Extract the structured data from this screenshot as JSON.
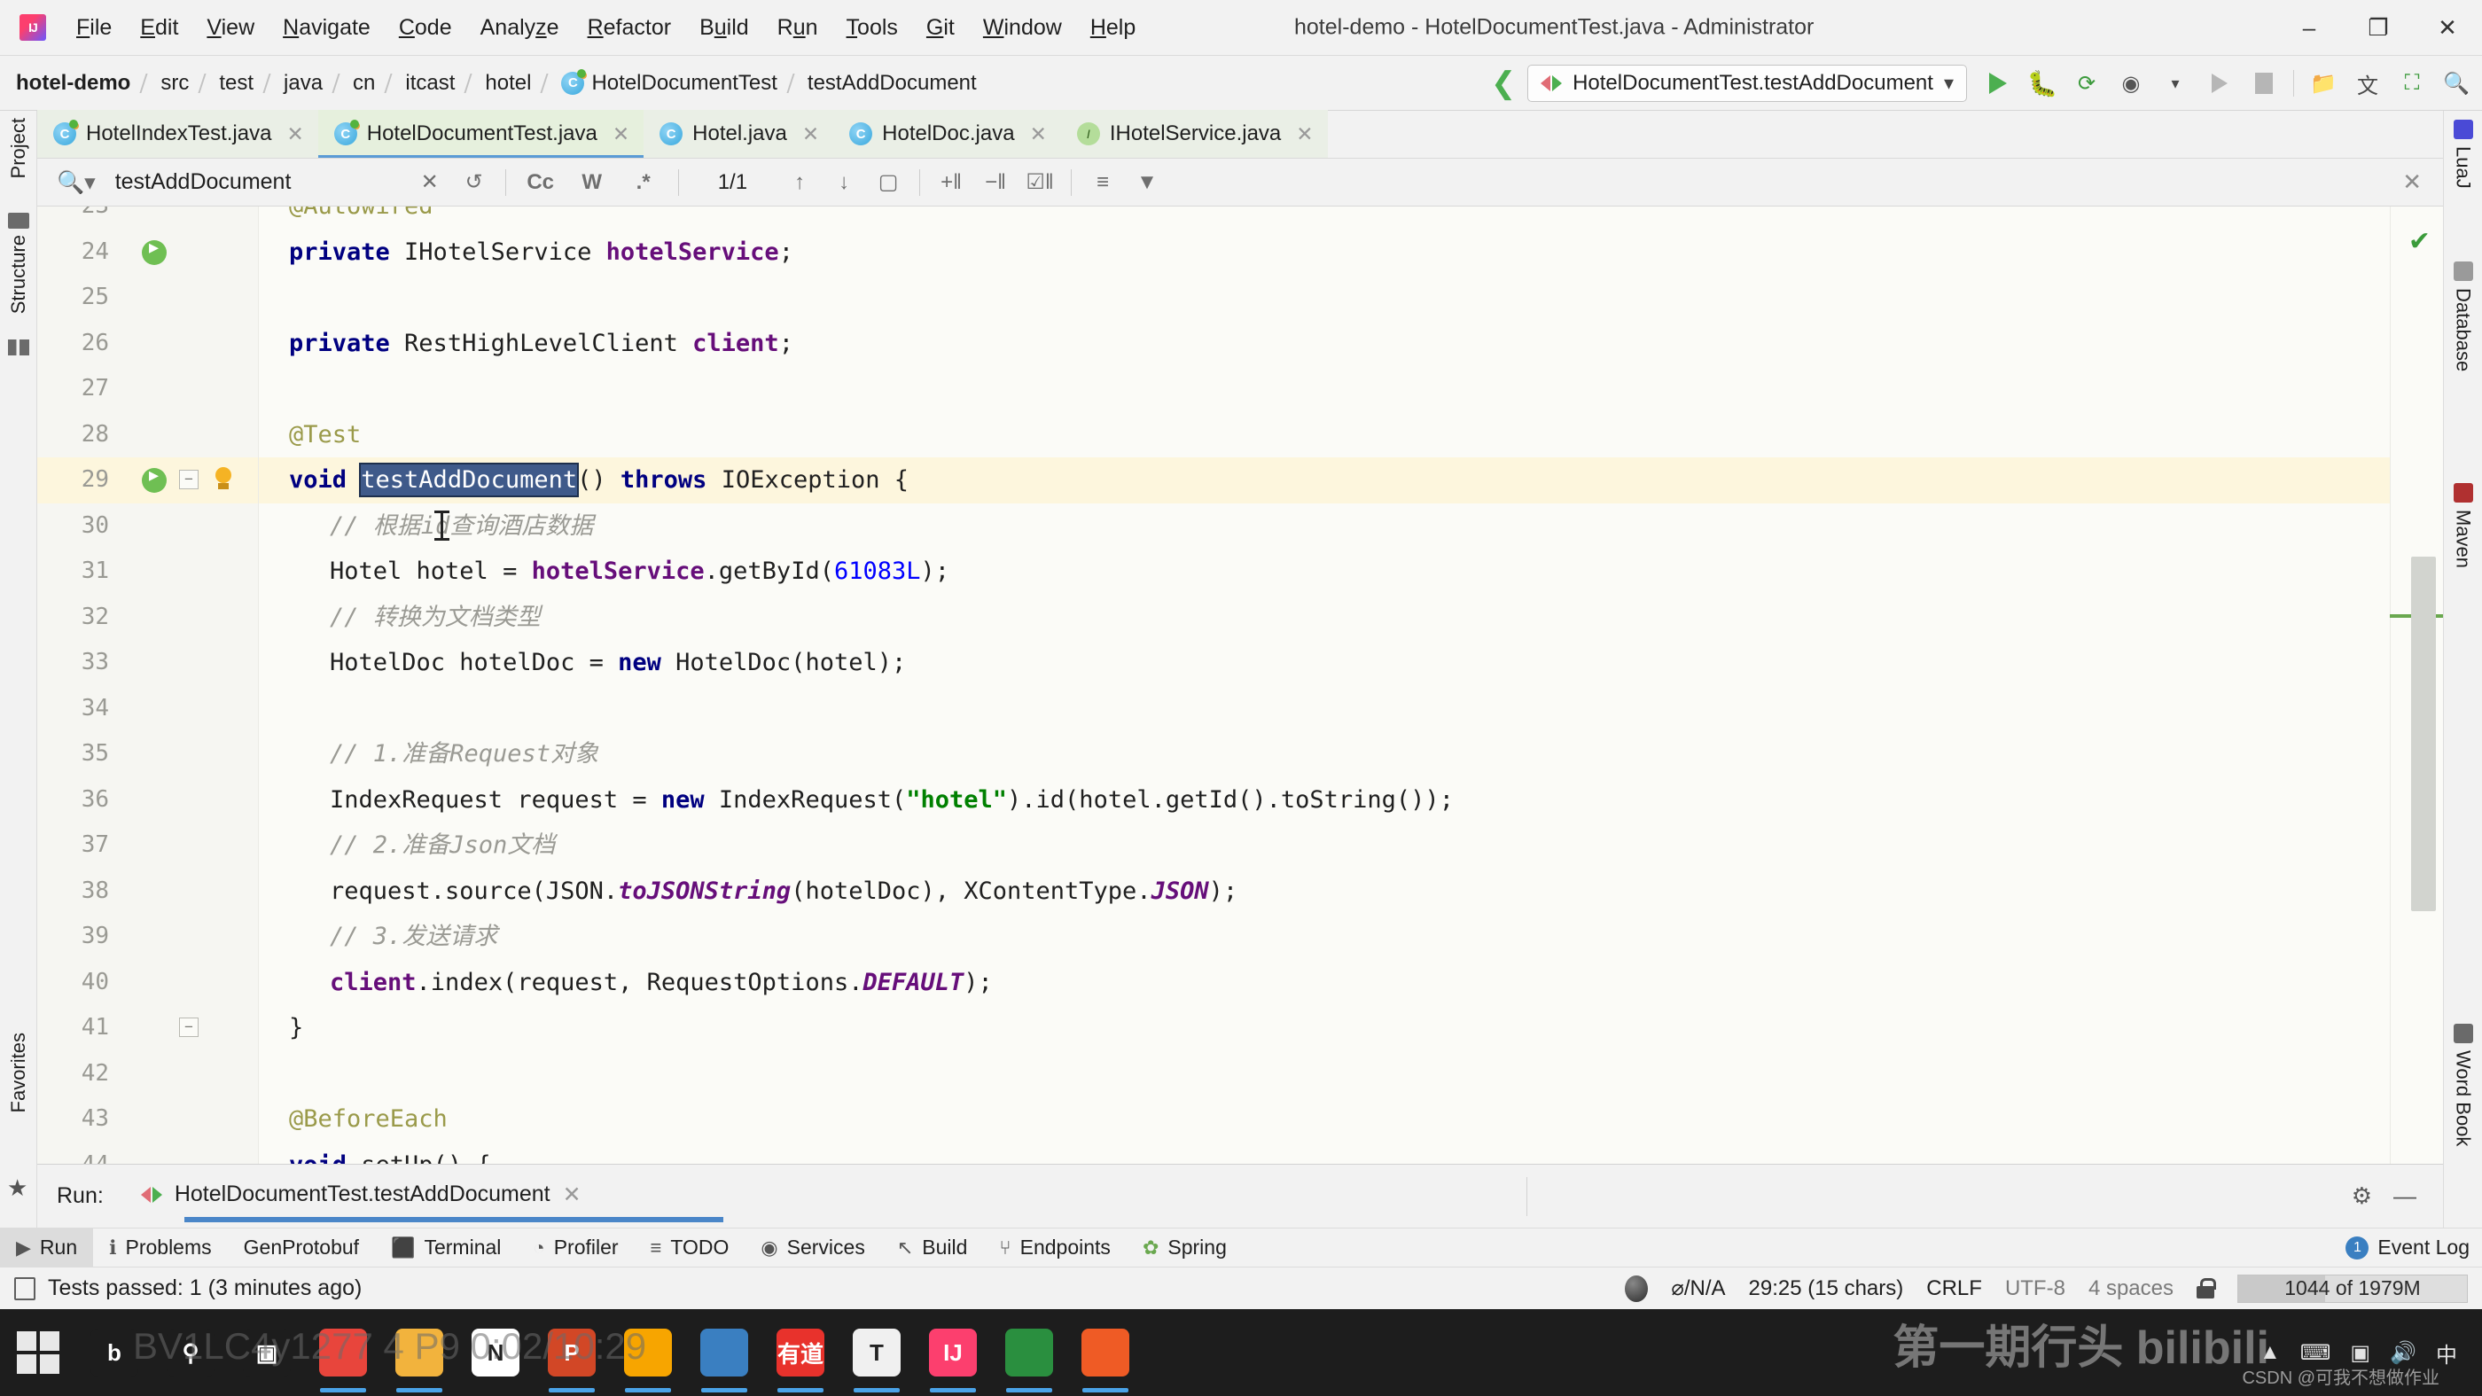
{
  "window": {
    "title": "hotel-demo - HotelDocumentTest.java - Administrator",
    "minimize": "–",
    "maximize": "❐",
    "close": "✕",
    "logo": "intellij-idea-logo"
  },
  "menubar": {
    "items": [
      {
        "pre": "",
        "mn": "F",
        "post": "ile"
      },
      {
        "pre": "",
        "mn": "E",
        "post": "dit"
      },
      {
        "pre": "",
        "mn": "V",
        "post": "iew"
      },
      {
        "pre": "",
        "mn": "N",
        "post": "avigate"
      },
      {
        "pre": "",
        "mn": "C",
        "post": "ode"
      },
      {
        "pre": "Analy",
        "mn": "z",
        "post": "e"
      },
      {
        "pre": "",
        "mn": "R",
        "post": "efactor"
      },
      {
        "pre": "B",
        "mn": "u",
        "post": "ild"
      },
      {
        "pre": "R",
        "mn": "u",
        "post": "n"
      },
      {
        "pre": "",
        "mn": "T",
        "post": "ools"
      },
      {
        "pre": "",
        "mn": "G",
        "post": "it"
      },
      {
        "pre": "",
        "mn": "W",
        "post": "indow"
      },
      {
        "pre": "",
        "mn": "H",
        "post": "elp"
      }
    ]
  },
  "breadcrumbs": {
    "items": [
      {
        "label": "hotel-demo",
        "bold": true,
        "icon": "none"
      },
      {
        "label": "src",
        "bold": false,
        "icon": "none"
      },
      {
        "label": "test",
        "bold": false,
        "icon": "none"
      },
      {
        "label": "java",
        "bold": false,
        "icon": "none"
      },
      {
        "label": "cn",
        "bold": false,
        "icon": "none"
      },
      {
        "label": "itcast",
        "bold": false,
        "icon": "none"
      },
      {
        "label": "hotel",
        "bold": false,
        "icon": "none"
      },
      {
        "label": "HotelDocumentTest",
        "bold": false,
        "icon": "class-test-icon"
      },
      {
        "label": "testAddDocument",
        "bold": false,
        "icon": "none"
      }
    ]
  },
  "run_toolbar": {
    "back_icon": "back-arrow-icon",
    "config_name": "HotelDocumentTest.testAddDocument",
    "config_chevron": "▾",
    "run_icon": "run-icon",
    "debug_icon": "debug-icon",
    "run_coverage_icon": "run-with-coverage-icon",
    "profiler_icon": "profiler-icon",
    "profiler_chevron": "▾",
    "rerun_icon": "rerun-icon",
    "stop_icon": "stop-icon",
    "update_icon": "update-project-icon",
    "translate_icon": "translate-icon",
    "console_icon": "console-icon",
    "search_icon": "search-everywhere-icon"
  },
  "editor_tabs": [
    {
      "label": "HotelIndexTest.java",
      "icon": "class-test-icon",
      "active": false,
      "close": "✕"
    },
    {
      "label": "HotelDocumentTest.java",
      "icon": "class-test-icon",
      "active": true,
      "close": "✕"
    },
    {
      "label": "Hotel.java",
      "icon": "class-icon",
      "active": false,
      "close": "✕"
    },
    {
      "label": "HotelDoc.java",
      "icon": "class-icon",
      "active": false,
      "close": "✕"
    },
    {
      "label": "IHotelService.java",
      "icon": "interface-icon",
      "active": false,
      "close": "✕"
    }
  ],
  "find_bar": {
    "search_icon": "search-dropdown-icon",
    "value": "testAddDocument",
    "placeholder": "Search",
    "clear": "✕",
    "history": "↺",
    "match_case": "Cc",
    "words": "W",
    "regex": ".*",
    "count": "1/1",
    "prev": "↑",
    "next": "↓",
    "select_all": "select-all-occurrences-icon",
    "add_line": "add-line-icon",
    "remove_line": "remove-line-icon",
    "check_line": "check-line-icon",
    "filter_results": "filter-results-icon",
    "filter": "filter-icon",
    "close": "✕"
  },
  "left_strip": {
    "project": "Project",
    "structure": "Structure",
    "favorites": "Favorites"
  },
  "right_strip": {
    "items": [
      "LuaJ",
      "Database",
      "Maven",
      "Word Book"
    ]
  },
  "editor": {
    "lines": [
      {
        "num": "23",
        "indent": 0,
        "tokens": [
          {
            "t": "@Autowired",
            "c": "ann"
          }
        ],
        "clipped": true
      },
      {
        "num": "24",
        "indent": 0,
        "gutter": "run-marker",
        "tokens": [
          {
            "t": "private ",
            "c": "kw"
          },
          {
            "t": "IHotelService ",
            "c": "pln"
          },
          {
            "t": "hotelService",
            "c": "fld"
          },
          {
            "t": ";",
            "c": "pln"
          }
        ]
      },
      {
        "num": "25",
        "indent": 0,
        "tokens": []
      },
      {
        "num": "26",
        "indent": 0,
        "tokens": [
          {
            "t": "private ",
            "c": "kw"
          },
          {
            "t": "RestHighLevelClient ",
            "c": "pln"
          },
          {
            "t": "client",
            "c": "fld"
          },
          {
            "t": ";",
            "c": "pln"
          }
        ]
      },
      {
        "num": "27",
        "indent": 0,
        "tokens": []
      },
      {
        "num": "28",
        "indent": 0,
        "tokens": [
          {
            "t": "@Test",
            "c": "ann"
          }
        ]
      },
      {
        "num": "29",
        "indent": 0,
        "gutter": "run-marker-bulb",
        "highlight": true,
        "tokens": [
          {
            "t": "void ",
            "c": "kw"
          },
          {
            "t": "testAddDocument",
            "c": "sel"
          },
          {
            "t": "() ",
            "c": "pln"
          },
          {
            "t": "throws ",
            "c": "kw"
          },
          {
            "t": "IOException {",
            "c": "pln"
          }
        ]
      },
      {
        "num": "30",
        "indent": 1,
        "caret": true,
        "tokens": [
          {
            "t": "// 根据id查询酒店数据",
            "c": "cmt"
          }
        ]
      },
      {
        "num": "31",
        "indent": 1,
        "tokens": [
          {
            "t": "Hotel hotel = ",
            "c": "pln"
          },
          {
            "t": "hotelService",
            "c": "fld"
          },
          {
            "t": ".getById(",
            "c": "pln"
          },
          {
            "t": "61083L",
            "c": "num"
          },
          {
            "t": ");",
            "c": "pln"
          }
        ]
      },
      {
        "num": "32",
        "indent": 1,
        "tokens": [
          {
            "t": "// 转换为文档类型",
            "c": "cmt"
          }
        ]
      },
      {
        "num": "33",
        "indent": 1,
        "tokens": [
          {
            "t": "HotelDoc hotelDoc = ",
            "c": "pln"
          },
          {
            "t": "new ",
            "c": "kw"
          },
          {
            "t": "HotelDoc(hotel);",
            "c": "pln"
          }
        ]
      },
      {
        "num": "34",
        "indent": 1,
        "tokens": []
      },
      {
        "num": "35",
        "indent": 1,
        "tokens": [
          {
            "t": "// 1.准备Request对象",
            "c": "cmt"
          }
        ]
      },
      {
        "num": "36",
        "indent": 1,
        "tokens": [
          {
            "t": "IndexRequest request = ",
            "c": "pln"
          },
          {
            "t": "new ",
            "c": "kw"
          },
          {
            "t": "IndexRequest(",
            "c": "pln"
          },
          {
            "t": "\"hotel\"",
            "c": "str"
          },
          {
            "t": ").id(hotel.getId().toString());",
            "c": "pln"
          }
        ]
      },
      {
        "num": "37",
        "indent": 1,
        "tokens": [
          {
            "t": "// 2.准备Json文档",
            "c": "cmt"
          }
        ]
      },
      {
        "num": "38",
        "indent": 1,
        "tokens": [
          {
            "t": "request.source(JSON.",
            "c": "pln"
          },
          {
            "t": "toJSONString",
            "c": "stc"
          },
          {
            "t": "(hotelDoc), XContentType.",
            "c": "pln"
          },
          {
            "t": "JSON",
            "c": "stc"
          },
          {
            "t": ");",
            "c": "pln"
          }
        ]
      },
      {
        "num": "39",
        "indent": 1,
        "tokens": [
          {
            "t": "// 3.发送请求",
            "c": "cmt"
          }
        ]
      },
      {
        "num": "40",
        "indent": 1,
        "tokens": [
          {
            "t": "client",
            "c": "fld"
          },
          {
            "t": ".index(request, RequestOptions.",
            "c": "pln"
          },
          {
            "t": "DEFAULT",
            "c": "stc"
          },
          {
            "t": ");",
            "c": "pln"
          }
        ]
      },
      {
        "num": "41",
        "indent": 0,
        "gutter": "fold",
        "tokens": [
          {
            "t": "}",
            "c": "pln"
          }
        ]
      },
      {
        "num": "42",
        "indent": 0,
        "tokens": []
      },
      {
        "num": "43",
        "indent": 0,
        "tokens": [
          {
            "t": "@BeforeEach",
            "c": "ann"
          }
        ]
      },
      {
        "num": "44",
        "indent": 0,
        "clipped_bottom": true,
        "tokens": [
          {
            "t": "void ",
            "c": "kw"
          },
          {
            "t": "setUp() {",
            "c": "pln"
          }
        ]
      }
    ],
    "ok_check": "✔"
  },
  "run_panel": {
    "label": "Run:",
    "tab_title": "HotelDocumentTest.testAddDocument",
    "tab_close": "✕",
    "settings_icon": "gear-icon",
    "minimize_icon": "—"
  },
  "bottom_toolwindows": [
    {
      "label": "Run",
      "icon": "run-icon",
      "active": true
    },
    {
      "label": "Problems",
      "icon": "problems-icon",
      "active": false
    },
    {
      "label": "GenProtobuf",
      "icon": "",
      "active": false
    },
    {
      "label": "Terminal",
      "icon": "terminal-icon",
      "active": false
    },
    {
      "label": "Profiler",
      "icon": "profiler-icon",
      "active": false
    },
    {
      "label": "TODO",
      "icon": "todo-icon",
      "active": false
    },
    {
      "label": "Services",
      "icon": "services-icon",
      "active": false
    },
    {
      "label": "Build",
      "icon": "build-icon",
      "active": false
    },
    {
      "label": "Endpoints",
      "icon": "endpoints-icon",
      "active": false
    },
    {
      "label": "Spring",
      "icon": "spring-icon",
      "active": false
    }
  ],
  "event_log": {
    "label": "Event Log",
    "badge": "1"
  },
  "status_bar": {
    "message": "Tests passed: 1 (3 minutes ago)",
    "doc_icon": "document-icon",
    "vcs": "⌀/N/A",
    "caret_pos": "29:25 (15 chars)",
    "line_sep": "CRLF",
    "encoding": "UTF-8",
    "indent": "4 spaces",
    "lock_icon": "lock-icon",
    "memory": "1044 of 1979M"
  },
  "taskbar": {
    "start": "windows-start-icon",
    "items": [
      {
        "name": "bilibili-icon",
        "label": "b",
        "color": "#1d1d1d",
        "running": false
      },
      {
        "name": "search-icon",
        "label": "⚲",
        "color": "#1d1d1d",
        "running": false
      },
      {
        "name": "task-view-icon",
        "label": "▣",
        "color": "#1d1d1d",
        "running": false
      },
      {
        "name": "chrome-icon",
        "label": "",
        "color": "#e8453c",
        "running": true
      },
      {
        "name": "file-explorer-icon",
        "label": "",
        "color": "#f2b33d",
        "running": true
      },
      {
        "name": "notepad-icon",
        "label": "N",
        "color": "#ffffff",
        "running": false
      },
      {
        "name": "powerpoint-icon",
        "label": "P",
        "color": "#d24726",
        "running": true
      },
      {
        "name": "vmware-icon",
        "label": "",
        "color": "#f7a500",
        "running": true
      },
      {
        "name": "remote-desktop-icon",
        "label": "",
        "color": "#3a7fc1",
        "running": true
      },
      {
        "name": "youdao-dict-icon",
        "label": "有道",
        "color": "#e8322c",
        "running": true
      },
      {
        "name": "typora-icon",
        "label": "T",
        "color": "#f0f0f0",
        "running": true
      },
      {
        "name": "intellij-idea-icon",
        "label": "IJ",
        "color": "#fc3f6e",
        "running": true
      },
      {
        "name": "navicat-icon",
        "label": "",
        "color": "#2a8f3f",
        "running": true
      },
      {
        "name": "postman-icon",
        "label": "",
        "color": "#ef5b25",
        "running": true
      }
    ],
    "tray": [
      "▲",
      "⌨",
      "▣",
      "🔊",
      "中"
    ],
    "ghost_overlay": "BV1LC4y1277 4 P9  0:02/10:29",
    "ghost_overlay_2": "第一期行头 bilibili",
    "watermark": "CSDN @可我不想做作业"
  },
  "colors": {
    "accent": "#4a86c8",
    "run_green": "#4caf50",
    "selection": "#3f5a8a",
    "highlight_line": "#fdf6dd"
  }
}
